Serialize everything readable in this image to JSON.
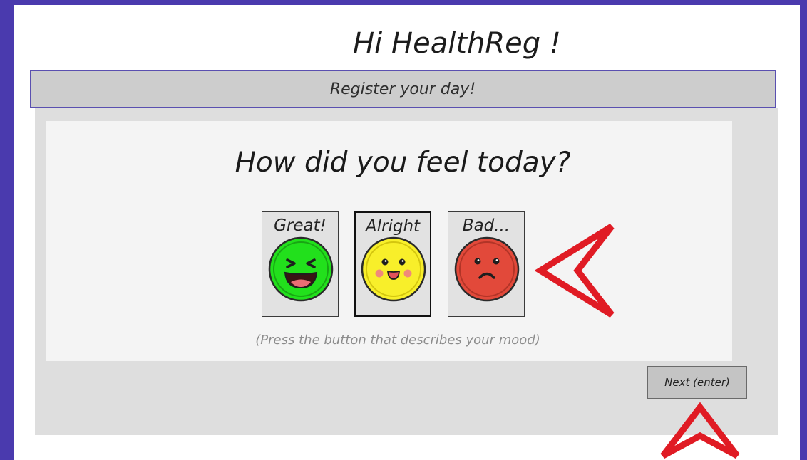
{
  "header": {
    "title": "Hi HealthReg !"
  },
  "banner": {
    "text": "Register your day!"
  },
  "question": {
    "text": "How did you feel today?"
  },
  "moods": [
    {
      "label": "Great!",
      "icon": "laughing-face-icon",
      "color": "#22e01c",
      "selected": false
    },
    {
      "label": "Alright",
      "icon": "smiling-face-icon",
      "color": "#f8ef2a",
      "selected": true
    },
    {
      "label": "Bad...",
      "icon": "sad-face-icon",
      "color": "#e2493a",
      "selected": false
    }
  ],
  "hint": {
    "text": "(Press the button that describes your mood)"
  },
  "next_button": {
    "label": "Next (enter)"
  },
  "colors": {
    "frame": "#4a3aae",
    "banner": "#cdcdcd",
    "panel": "#dedede",
    "card": "#f4f4f4",
    "arrow": "#e01b24"
  }
}
